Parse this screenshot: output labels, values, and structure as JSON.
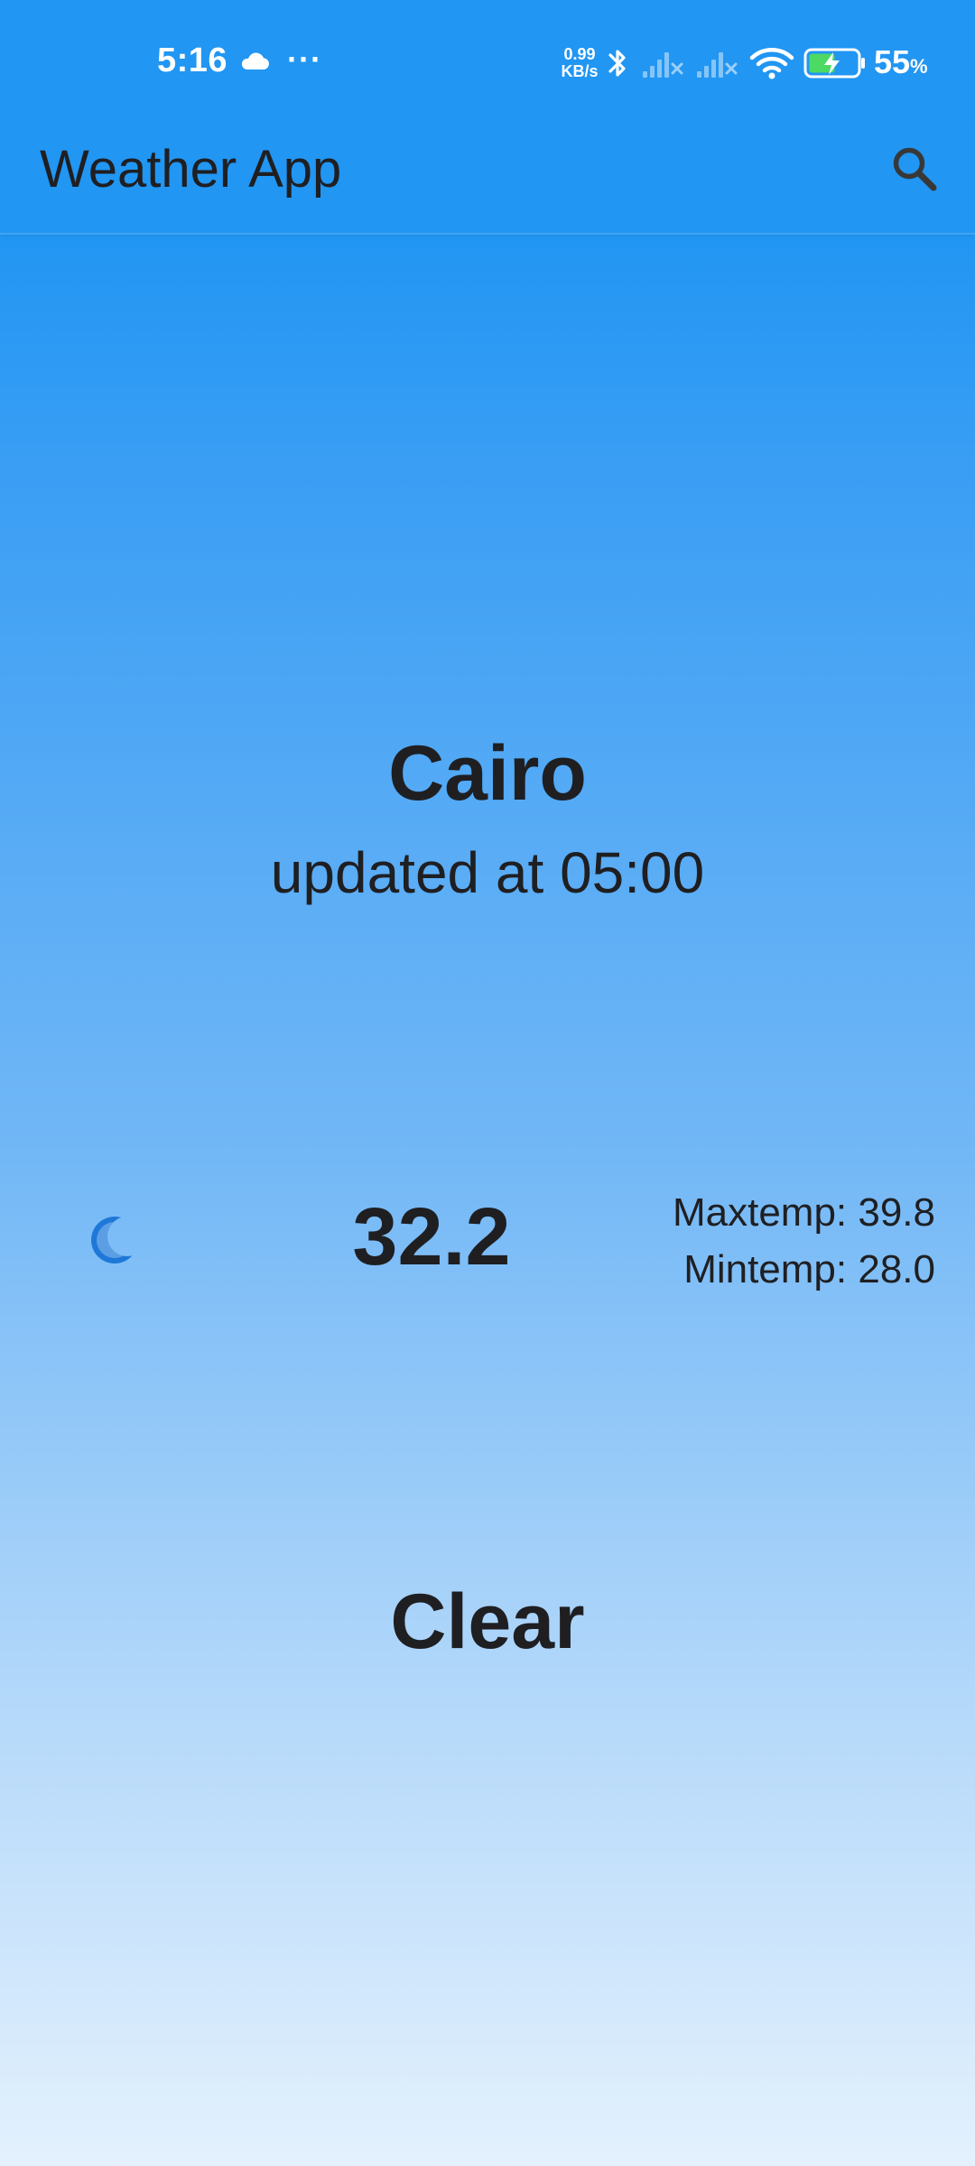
{
  "status_bar": {
    "time": "5:16",
    "more": "···",
    "speed_value": "0.99",
    "speed_unit": "KB/s",
    "battery_percent": "55",
    "percent_sign": "%",
    "icons": [
      "cloud-icon",
      "bluetooth-icon",
      "signal-icon",
      "signal-icon",
      "wifi-icon",
      "battery-charging-icon"
    ]
  },
  "app_bar": {
    "title": "Weather App",
    "search_icon": "search-icon"
  },
  "weather": {
    "city": "Cairo",
    "updated": "updated at 05:00",
    "icon": "moon-icon",
    "temp": "32.2",
    "max_temp": "Maxtemp: 39.8",
    "min_temp": "Mintemp: 28.0",
    "condition": "Clear"
  },
  "colors": {
    "app_bar": "#2196f3",
    "gradient_top": "#2196f3",
    "gradient_bottom": "#e4f1fd",
    "text": "#1f1f22",
    "moon": "#1e78d8"
  }
}
